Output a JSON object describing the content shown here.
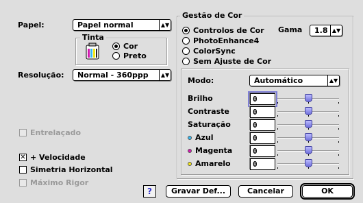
{
  "paper": {
    "label": "Papel:",
    "value": "Papel normal"
  },
  "ink": {
    "title": "Tinta",
    "options": [
      {
        "label": "Cor",
        "selected": true
      },
      {
        "label": "Preto",
        "selected": false
      }
    ]
  },
  "resolution": {
    "label": "Resolução:",
    "value": "Normal - 360ppp"
  },
  "checkboxes": {
    "interleaved": {
      "label": "Entrelaçado",
      "checked": false,
      "disabled": true
    },
    "speed": {
      "label": "+ Velocidade",
      "checked": true,
      "disabled": false
    },
    "flip": {
      "label": "Simetria Horizontal",
      "checked": false,
      "disabled": false
    },
    "max_rigor": {
      "label": "Máximo Rigor",
      "checked": false,
      "disabled": true
    }
  },
  "color_mgmt": {
    "title": "Gestão de Cor",
    "options": [
      {
        "label": "Controlos de Cor",
        "selected": true
      },
      {
        "label": "PhotoEnhance4",
        "selected": false
      },
      {
        "label": "ColorSync",
        "selected": false
      },
      {
        "label": "Sem Ajuste de Cor",
        "selected": false
      }
    ],
    "gamma": {
      "label": "Gama",
      "value": "1.8"
    },
    "mode": {
      "label": "Modo:",
      "value": "Automático"
    },
    "sliders": [
      {
        "label": "Brilho",
        "value": "0",
        "position": 0.5,
        "dot": null
      },
      {
        "label": "Contraste",
        "value": "0",
        "position": 0.5,
        "dot": null
      },
      {
        "label": "Saturação",
        "value": "0",
        "position": 0.5,
        "dot": null
      },
      {
        "label": "Azul",
        "value": "0",
        "position": 0.5,
        "dot": "#39b7ee"
      },
      {
        "label": "Magenta",
        "value": "0",
        "position": 0.5,
        "dot": "#d21ab0"
      },
      {
        "label": "Amarelo",
        "value": "0",
        "position": 0.5,
        "dot": "#f2e619"
      }
    ]
  },
  "buttons": {
    "help": "?",
    "save_defaults": "Gravar Def...",
    "cancel": "Cancelar",
    "ok": "OK"
  },
  "icons": {
    "ink_cartridge": "ink-cartridge-icon",
    "popup_arrows": "⇕"
  }
}
